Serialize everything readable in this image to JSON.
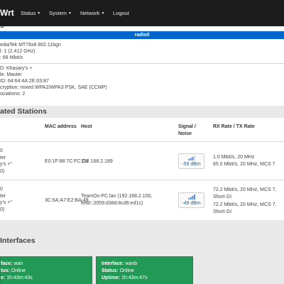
{
  "navbar": {
    "brand": "Wrt",
    "items": [
      {
        "label": "Status",
        "caret": "▼"
      },
      {
        "label": "System",
        "caret": "▼"
      },
      {
        "label": "Network",
        "caret": "▼"
      },
      {
        "label": "Logout"
      }
    ]
  },
  "wireless": {
    "heading": "s",
    "radio_label": "radio0",
    "device_lines": [
      "ediaTek MT76x8 802.11bgn",
      "l: 1 (2.412 GHz)",
      ": 68 Mbit/s"
    ],
    "network_lines": [
      "D: Khasary's +",
      "le: Master",
      "ID: 64:64:4A:2E:03:87",
      "cryption: mixed WPA2/WPA3 PSK, SAE (CCMP)",
      "ociations: 2"
    ]
  },
  "stations": {
    "title": "ated Stations",
    "columns": {
      "mac": "MAC address",
      "host": "Host",
      "signal_line1": "Signal /",
      "signal_line2": "Noise",
      "rate": "RX Rate / TX Rate"
    },
    "rows": [
      {
        "left_lines": [
          "0",
          "ter",
          "y's +\"",
          "0)"
        ],
        "mac": "E0:1F:88:7C:FC:C4",
        "host_lines": [
          "192.168.2.189"
        ],
        "signal": "-59 dBm",
        "rate_lines": [
          "1.0 Mbit/s, 20 MHz",
          "65.0 Mbit/s, 20 MHz, MCS 7"
        ]
      },
      {
        "left_lines": [
          "0",
          "ter",
          "y's +\"",
          "0)"
        ],
        "mac": "3C:6A:A7:E2:BA:49",
        "host_lines": [
          "TeamOs-PC.lan (192.168.2.100,",
          "fe80::2059:d38d:8cd6:ed1c)"
        ],
        "signal": "-49 dBm",
        "rate_lines": [
          "72.2 Mbit/s, 20 MHz, MCS 7,",
          "Short GI",
          "72.2 Mbit/s, 20 MHz, MCS 7,",
          "Short GI"
        ]
      }
    ]
  },
  "interfaces": {
    "title": " Interfaces",
    "cards": [
      {
        "interface_label": "face:",
        "interface_value": "wan",
        "status_label": "tus:",
        "status_value": "Online",
        "uptime_label": "e:",
        "uptime_value": "1h:43m:43s"
      },
      {
        "interface_label": "Interface:",
        "interface_value": "wanb",
        "status_label": "Status:",
        "status_value": "Online",
        "uptime_label": "Uptime:",
        "uptime_value": "1h:43m:47s"
      }
    ]
  },
  "colors": {
    "navbar": "#1c1c1c",
    "radio_bar": "#0066cc",
    "interface_card": "#229955",
    "signal_text": "#0a6aa1"
  },
  "icons": {
    "signal": "signal-strength-icon"
  }
}
